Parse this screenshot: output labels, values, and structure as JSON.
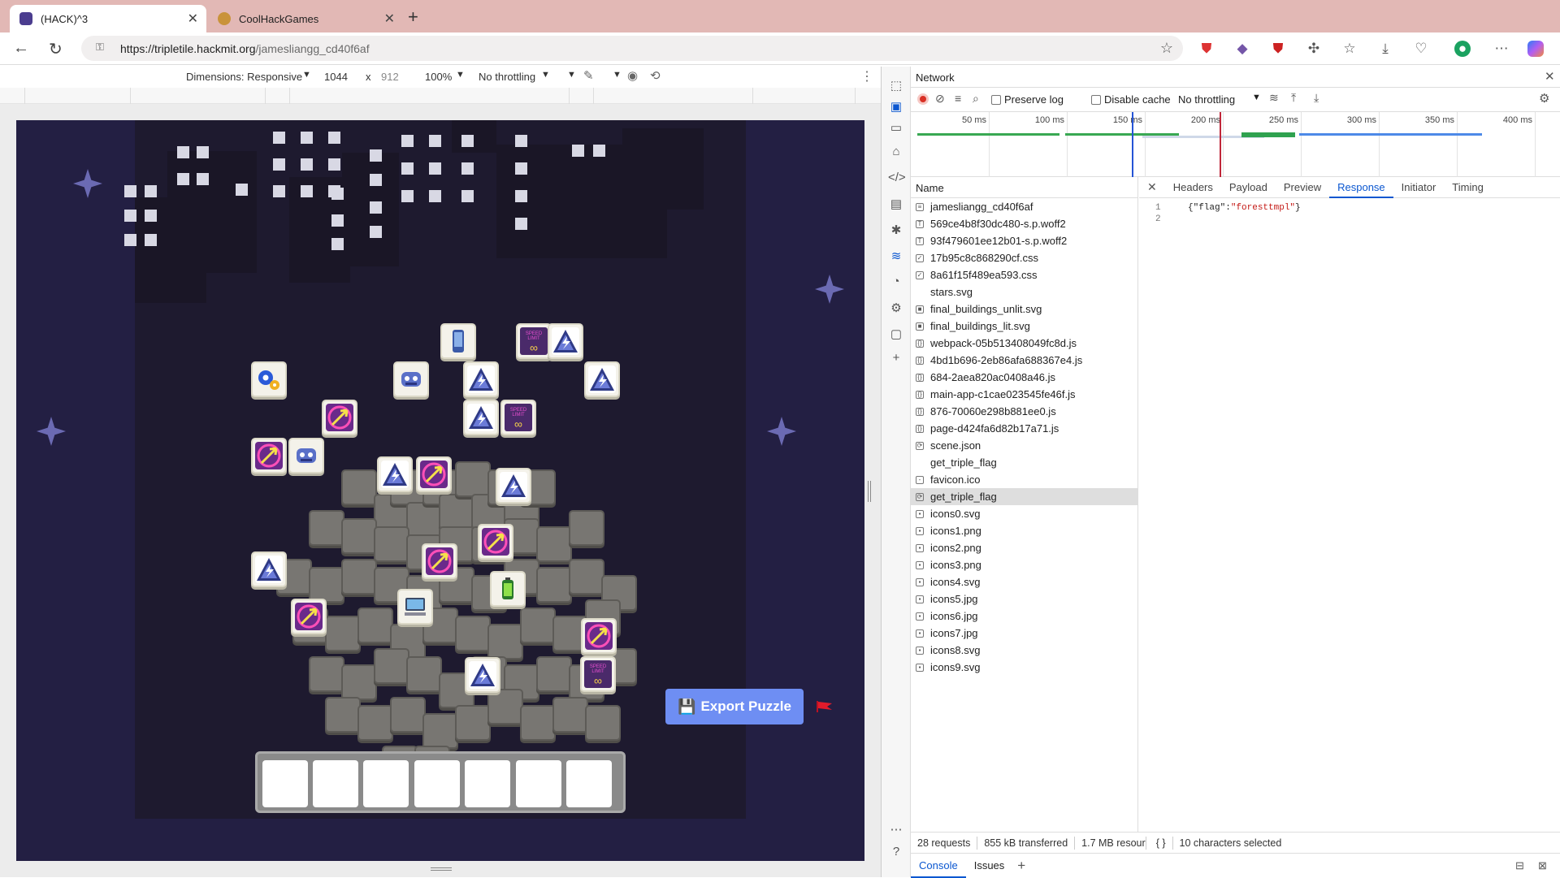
{
  "browser": {
    "tabs": [
      {
        "title": "(HACK)^3",
        "active": true
      },
      {
        "title": "CoolHackGames",
        "active": false
      }
    ],
    "url_host": "https://tripletile.hackmit.org",
    "url_path": "/jamesliangg_cd40f6af"
  },
  "device_toolbar": {
    "dimensions_label": "Dimensions: Responsive",
    "width": "1044",
    "times": "x",
    "height": "912",
    "zoom": "100%",
    "throttling": "No throttling"
  },
  "game": {
    "export_label": "Export Puzzle",
    "export_icon": "floppy-disk-icon",
    "slot_count": 7
  },
  "devtools": {
    "panel_title": "Network",
    "preserve_log": "Preserve log",
    "disable_cache": "Disable cache",
    "throttling": "No throttling",
    "timeline_ticks": [
      "50 ms",
      "100 ms",
      "150 ms",
      "200 ms",
      "250 ms",
      "300 ms",
      "350 ms",
      "400 ms"
    ],
    "name_header": "Name",
    "requests": [
      {
        "name": "jamesliangg_cd40f6af",
        "type": "doc"
      },
      {
        "name": "569ce4b8f30dc480-s.p.woff2",
        "type": "font"
      },
      {
        "name": "93f479601ee12b01-s.p.woff2",
        "type": "font"
      },
      {
        "name": "17b95c8c868290cf.css",
        "type": "css"
      },
      {
        "name": "8a61f15f489ea593.css",
        "type": "css"
      },
      {
        "name": "stars.svg",
        "type": "svg"
      },
      {
        "name": "final_buildings_unlit.svg",
        "type": "svg-dark"
      },
      {
        "name": "final_buildings_lit.svg",
        "type": "svg-dark"
      },
      {
        "name": "webpack-05b513408049fc8d.js",
        "type": "js"
      },
      {
        "name": "4bd1b696-2eb86afa688367e4.js",
        "type": "js"
      },
      {
        "name": "684-2aea820ac0408a46.js",
        "type": "js"
      },
      {
        "name": "main-app-c1cae023545fe46f.js",
        "type": "js"
      },
      {
        "name": "876-70060e298b881ee0.js",
        "type": "js"
      },
      {
        "name": "page-d424fa6d82b17a71.js",
        "type": "js"
      },
      {
        "name": "scene.json",
        "type": "fetch"
      },
      {
        "name": "get_triple_flag",
        "type": "none"
      },
      {
        "name": "favicon.ico",
        "type": "ico"
      },
      {
        "name": "get_triple_flag",
        "type": "fetch",
        "selected": true
      },
      {
        "name": "icons0.svg",
        "type": "img"
      },
      {
        "name": "icons1.png",
        "type": "img"
      },
      {
        "name": "icons2.png",
        "type": "img"
      },
      {
        "name": "icons3.png",
        "type": "img"
      },
      {
        "name": "icons4.svg",
        "type": "img"
      },
      {
        "name": "icons5.jpg",
        "type": "img"
      },
      {
        "name": "icons6.jpg",
        "type": "img"
      },
      {
        "name": "icons7.jpg",
        "type": "img"
      },
      {
        "name": "icons8.svg",
        "type": "img"
      },
      {
        "name": "icons9.svg",
        "type": "img"
      }
    ],
    "detail_tabs": [
      "Headers",
      "Payload",
      "Preview",
      "Response",
      "Initiator",
      "Timing"
    ],
    "active_detail_tab": "Response",
    "response_lines": [
      {
        "num": "1",
        "prefix": "{\"flag\":",
        "value": "\"foresttmpl\"",
        "suffix": "}"
      },
      {
        "num": "2",
        "prefix": "",
        "value": "",
        "suffix": ""
      }
    ],
    "status": {
      "requests": "28 requests",
      "transferred": "855 kB transferred",
      "resources": "1.7 MB resour",
      "braces": "{ }",
      "selection": "10 characters selected"
    },
    "drawer_tabs": [
      "Console",
      "Issues"
    ]
  }
}
